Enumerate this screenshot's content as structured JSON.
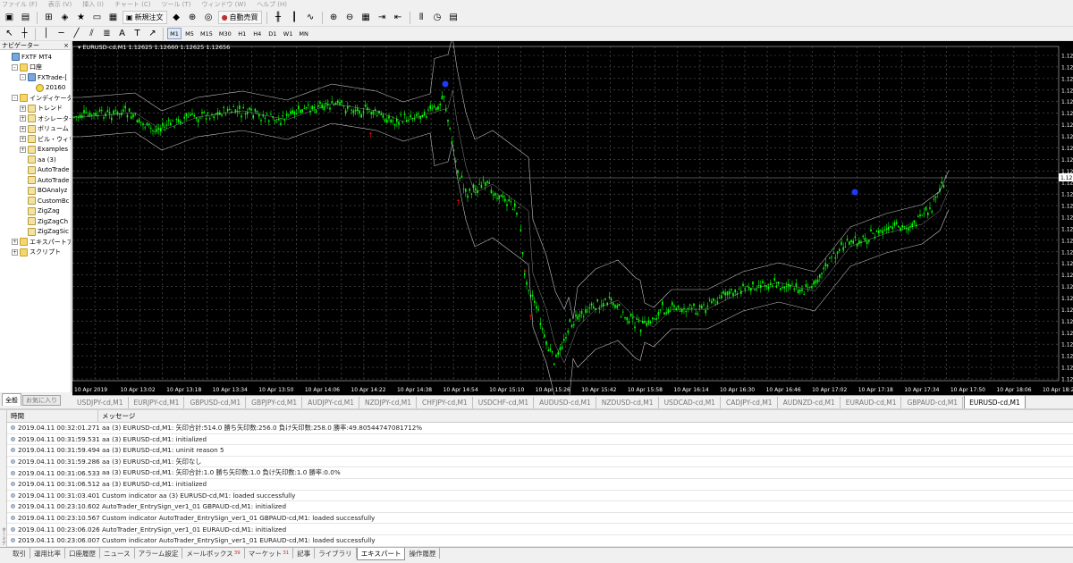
{
  "menu": [
    "ファイル (F)",
    "表示 (V)",
    "挿入 (I)",
    "チャート (C)",
    "ツール (T)",
    "ウィンドウ (W)",
    "ヘルプ (H)"
  ],
  "toolbar": {
    "new_order_label": "新規注文",
    "auto_trade_label": "自動売買",
    "timeframes": [
      "M1",
      "M5",
      "M15",
      "M30",
      "H1",
      "H4",
      "D1",
      "W1",
      "MN"
    ],
    "selected_timeframe": "M1"
  },
  "navigator": {
    "title": "ナビゲーター",
    "close": "×",
    "items": [
      {
        "label": "FXTF MT4",
        "level": 0,
        "icon": "terminal-icon",
        "expander": ""
      },
      {
        "label": "口座",
        "level": 1,
        "icon": "accounts-folder-icon",
        "expander": "-"
      },
      {
        "label": "FXTrade-[",
        "level": 2,
        "icon": "server-icon",
        "expander": "-"
      },
      {
        "label": "20160",
        "level": 3,
        "icon": "user-account-icon",
        "expander": ""
      },
      {
        "label": "インディケータ",
        "level": 1,
        "icon": "indicators-folder-icon",
        "expander": "-"
      },
      {
        "label": "トレンド",
        "level": 2,
        "icon": "folder-icon",
        "expander": "+"
      },
      {
        "label": "オシレーター",
        "level": 2,
        "icon": "folder-icon",
        "expander": "+"
      },
      {
        "label": "ボリューム",
        "level": 2,
        "icon": "folder-icon",
        "expander": "+"
      },
      {
        "label": "ビル・ウィリ",
        "level": 2,
        "icon": "folder-icon",
        "expander": "+"
      },
      {
        "label": "Examples",
        "level": 2,
        "icon": "folder-icon",
        "expander": "+"
      },
      {
        "label": "aa (3)",
        "level": 2,
        "icon": "indicator-icon",
        "expander": ""
      },
      {
        "label": "AutoTrade",
        "level": 2,
        "icon": "indicator-icon",
        "expander": ""
      },
      {
        "label": "AutoTrade",
        "level": 2,
        "icon": "indicator-icon",
        "expander": ""
      },
      {
        "label": "BOAnalyz",
        "level": 2,
        "icon": "indicator-icon",
        "expander": ""
      },
      {
        "label": "CustomBc",
        "level": 2,
        "icon": "indicator-icon",
        "expander": ""
      },
      {
        "label": "ZigZag",
        "level": 2,
        "icon": "indicator-icon",
        "expander": ""
      },
      {
        "label": "ZigZagCh",
        "level": 2,
        "icon": "indicator-icon",
        "expander": ""
      },
      {
        "label": "ZigZagSic",
        "level": 2,
        "icon": "indicator-icon",
        "expander": ""
      },
      {
        "label": "エキスパートアド",
        "level": 1,
        "icon": "experts-folder-icon",
        "expander": "+"
      },
      {
        "label": "スクリプト",
        "level": 1,
        "icon": "scripts-folder-icon",
        "expander": "+"
      }
    ],
    "tabs": [
      "全般",
      "お気に入り"
    ]
  },
  "chart_data": {
    "type": "candlestick",
    "symbol_header": "EURUSD-cd,M1  1.12625 1.12660 1.12625 1.12656",
    "background": "#000000",
    "grid": true,
    "bull_color": "#00ff00",
    "bear_color": "#00ff00",
    "band_color": "#c0c0c0",
    "x_tick_labels": [
      "10 Apr 2019",
      "10 Apr 13:02",
      "10 Apr 13:18",
      "10 Apr 13:34",
      "10 Apr 13:50",
      "10 Apr 14:06",
      "10 Apr 14:22",
      "10 Apr 14:38",
      "10 Apr 14:54",
      "10 Apr 15:10",
      "10 Apr 15:26",
      "10 Apr 15:42",
      "10 Apr 15:58",
      "10 Apr 16:14",
      "10 Apr 16:30",
      "10 Apr 16:46",
      "10 Apr 17:02",
      "10 Apr 17:18",
      "10 Apr 17:34",
      "10 Apr 17:50",
      "10 Apr 18:06",
      "10 Apr 18:22"
    ],
    "y_tick_labels": [
      "1.12",
      "1.12",
      "1.12",
      "1.12",
      "1.12",
      "1.12",
      "1.12",
      "1.12",
      "1.12",
      "1.12",
      "1.12",
      "1.12",
      "1.12",
      "1.12",
      "1.12",
      "1.12",
      "1.12",
      "1.12",
      "1.12",
      "1.12",
      "1.12",
      "1.12",
      "1.12",
      "1.12",
      "1.12",
      "1.12",
      "1.12",
      "1.12",
      "1.12"
    ],
    "current_price_label": "1.12",
    "signal_arrow_color": "#ff0000",
    "signal_dot_color": "#1a3cff"
  },
  "symbol_tabs": [
    "EURUSD-cd,M1",
    "USDJPY-cd,M1",
    "EURJPY-cd,M1",
    "GBPUSD-cd,M1",
    "GBPJPY-cd,M1",
    "AUDJPY-cd,M1",
    "NZDJPY-cd,M1",
    "CHFJPY-cd,M1",
    "USDCHF-cd,M1",
    "AUDUSD-cd,M1",
    "NZDUSD-cd,M1",
    "USDCAD-cd,M1",
    "CADJPY-cd,M1",
    "AUDNZD-cd,M1",
    "EURAUD-cd,M1",
    "GBPAUD-cd,M1",
    "EURUSD-cd,M1"
  ],
  "active_symbol_tab": 16,
  "terminal": {
    "col_time": "時間",
    "col_message": "メッセージ",
    "rows": [
      {
        "time": "2019.04.11 00:32:01.271",
        "message": "aa (3) EURUSD-cd,M1: 矢印合計:514.0 勝ち矢印数:256.0 負け矢印数:258.0 勝率:49.80544747081712%"
      },
      {
        "time": "2019.04.11 00:31:59.531",
        "message": "aa (3) EURUSD-cd,M1: initialized"
      },
      {
        "time": "2019.04.11 00:31:59.494",
        "message": "aa (3) EURUSD-cd,M1: uninit reason 5"
      },
      {
        "time": "2019.04.11 00:31:59.286",
        "message": "aa (3) EURUSD-cd,M1: 矢印なし"
      },
      {
        "time": "2019.04.11 00:31:06.533",
        "message": "aa (3) EURUSD-cd,M1: 矢印合計:1.0 勝ち矢印数:1.0 負け矢印数:1.0 勝率:0.0%"
      },
      {
        "time": "2019.04.11 00:31:06.512",
        "message": "aa (3) EURUSD-cd,M1: initialized"
      },
      {
        "time": "2019.04.11 00:31:03.401",
        "message": "Custom indicator aa (3) EURUSD-cd,M1: loaded successfully"
      },
      {
        "time": "2019.04.11 00:23:10.602",
        "message": "AutoTrader_EntrySign_ver1_01 GBPAUD-cd,M1: initialized"
      },
      {
        "time": "2019.04.11 00:23:10.567",
        "message": "Custom indicator AutoTrader_EntrySign_ver1_01 GBPAUD-cd,M1: loaded successfully"
      },
      {
        "time": "2019.04.11 00:23:06.026",
        "message": "AutoTrader_EntrySign_ver1_01 EURAUD-cd,M1: initialized"
      },
      {
        "time": "2019.04.11 00:23:06.007",
        "message": "Custom indicator AutoTrader_EntrySign_ver1_01 EURAUD-cd,M1: loaded successfully"
      }
    ],
    "tabs": [
      {
        "label": "取引",
        "badge": ""
      },
      {
        "label": "運用比率",
        "badge": ""
      },
      {
        "label": "口座履歴",
        "badge": ""
      },
      {
        "label": "ニュース",
        "badge": ""
      },
      {
        "label": "アラーム設定",
        "badge": ""
      },
      {
        "label": "メールボックス",
        "badge": "39"
      },
      {
        "label": "マーケット",
        "badge": "31"
      },
      {
        "label": "記事",
        "badge": ""
      },
      {
        "label": "ライブラリ",
        "badge": ""
      },
      {
        "label": "エキスパート",
        "badge": ""
      },
      {
        "label": "操作履歴",
        "badge": ""
      }
    ],
    "active_tab": 9,
    "side_label": "ターミナル"
  }
}
